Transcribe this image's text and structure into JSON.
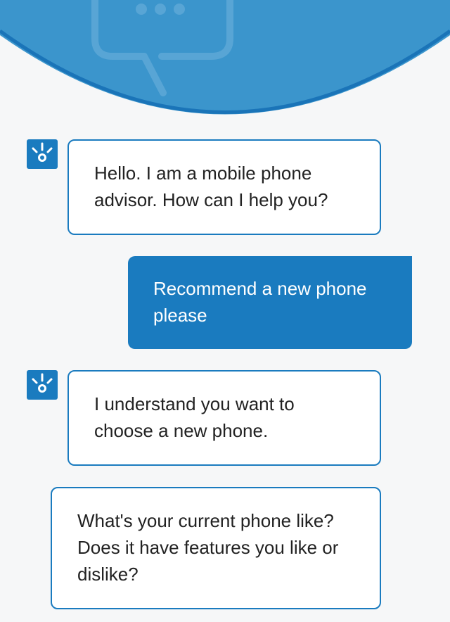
{
  "header": {
    "icon": "chat-bubble-icon",
    "colors": {
      "banner": "#3b95cc",
      "banner_edge": "#1a74b8"
    }
  },
  "messages": [
    {
      "sender": "bot",
      "text": "Hello. I am a mobile phone advisor. How can I help you?"
    },
    {
      "sender": "user",
      "text": "Recommend a new phone please"
    },
    {
      "sender": "bot",
      "text": "I understand you want to choose a new phone."
    },
    {
      "sender": "bot",
      "text": "What's your current phone like? Does it have features you like or dislike?"
    }
  ],
  "bot_avatar_icon": "bot-lightbulb-icon",
  "colors": {
    "accent": "#1a7bbf",
    "background": "#f6f7f8",
    "bot_bubble": "#ffffff",
    "user_text": "#ffffff"
  }
}
